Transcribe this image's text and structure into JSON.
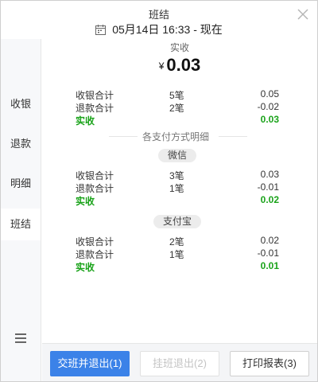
{
  "header": {
    "title": "班结",
    "date_range": "05月14日 16:33 - 现在"
  },
  "sidebar": {
    "items": [
      {
        "label": "收银"
      },
      {
        "label": "退款"
      },
      {
        "label": "明细"
      },
      {
        "label": "班结"
      }
    ],
    "active": "班结"
  },
  "summary": {
    "label": "实收",
    "currency": "¥",
    "amount": "0.03",
    "rows": [
      {
        "label": "收银合计",
        "count": "5笔",
        "amount": "0.05"
      },
      {
        "label": "退款合计",
        "count": "2笔",
        "amount": "-0.02"
      },
      {
        "label": "实收",
        "count": "",
        "amount": "0.03"
      }
    ]
  },
  "breakdown": {
    "title": "各支付方式明细",
    "methods": [
      {
        "name": "微信",
        "rows": [
          {
            "label": "收银合计",
            "count": "3笔",
            "amount": "0.03"
          },
          {
            "label": "退款合计",
            "count": "1笔",
            "amount": "-0.01"
          },
          {
            "label": "实收",
            "count": "",
            "amount": "0.02"
          }
        ]
      },
      {
        "name": "支付宝",
        "rows": [
          {
            "label": "收银合计",
            "count": "2笔",
            "amount": "0.02"
          },
          {
            "label": "退款合计",
            "count": "1笔",
            "amount": "-0.01"
          },
          {
            "label": "实收",
            "count": "",
            "amount": "0.01"
          }
        ]
      }
    ]
  },
  "footer": {
    "buttons": [
      {
        "label": "交班并退出(1)",
        "state": "primary"
      },
      {
        "label": "挂班退出(2)",
        "state": "disabled"
      },
      {
        "label": "打印报表(3)",
        "state": "normal"
      }
    ]
  },
  "colors": {
    "accent": "#3b82e8",
    "positive": "#1aa31a"
  }
}
